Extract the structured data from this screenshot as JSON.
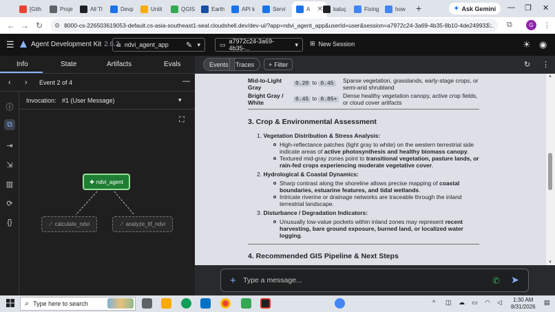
{
  "browser": {
    "tabs": [
      {
        "label": "[Gith",
        "color": "#ea4335"
      },
      {
        "label": "Proje",
        "color": "#5f6368"
      },
      {
        "label": "All Tl",
        "color": "#202124"
      },
      {
        "label": "Devp",
        "color": "#1a73e8"
      },
      {
        "label": "Untit",
        "color": "#f9ab00"
      },
      {
        "label": "QGIS",
        "color": "#34a853"
      },
      {
        "label": "Earth",
        "color": "#174ea6"
      },
      {
        "label": "API k",
        "color": "#1a73e8"
      },
      {
        "label": "Servi",
        "color": "#1a73e8"
      },
      {
        "label": "A",
        "color": "#1a73e8",
        "active": true
      },
      {
        "label": "kaluç",
        "color": "#202124"
      },
      {
        "label": "Fixing",
        "color": "#4285f4"
      },
      {
        "label": "how",
        "color": "#4285f4"
      }
    ],
    "new_tab": "+",
    "ask_gemini": "Ask Gemini",
    "url": "8000-cs-226503619053-default.cs-asia-southeast1-seal.cloudshell.dev/dev-ui/?app=ndvi_agent_app&userId=user&session=a7972c24-3a69-4b35-8b10-4de249933...",
    "profile_initial": "G"
  },
  "app": {
    "title": "Agent Development Kit",
    "version": "2.6.2",
    "app_selector": "ndvi_agent_app",
    "session_selector": "a7972c24-3a69-4b35-...",
    "new_session": "New Session"
  },
  "left": {
    "tabs": [
      "Info",
      "State",
      "Artifacts",
      "Evals"
    ],
    "event_label": "Event 2 of 4",
    "invocation_label": "Invocation:",
    "invocation_value": "#1 (User Message)",
    "graph": {
      "root": "ndvi_agent",
      "tools": [
        "calculate_ndvi",
        "analyze_tif_ndvi"
      ]
    }
  },
  "right": {
    "toggle": [
      "Events",
      "Traces"
    ],
    "filter": "Filter",
    "table_rows": [
      {
        "label": "Mid-to-Light Gray",
        "from": "0.20",
        "to_word": "to",
        "to": "0.45",
        "desc": "Sparse vegetation, grasslands, early-stage crops, or semi-arid shrubland"
      },
      {
        "label": "Bright Gray / White",
        "from": "0.45",
        "to_word": "to",
        "to": "0.85+",
        "desc": "Dense healthy vegetation canopy, active crop fields, or cloud cover artifacts"
      }
    ],
    "section3_title": "3. Crop & Environmental Assessment",
    "items": [
      {
        "num": "1.",
        "title": "Vegetation Distribution & Stress Analysis:",
        "bullets": [
          {
            "lines": [
              "High-reflectance patches (light gray to white) on the western terrestrial side",
              "indicate areas of ",
              "active photosynthesis and healthy biomass canopy",
              "."
            ]
          },
          {
            "lines": [
              "Textured mid-gray zones point to ",
              "transitional vegetation, pasture lands, or",
              "rain-fed crops experiencing moderate vegetative cover",
              "."
            ]
          }
        ]
      },
      {
        "num": "2.",
        "title": "Hydrological & Coastal Dynamics:",
        "bullets": [
          {
            "lines": [
              "Sharp contrast along the shoreline allows precise mapping of ",
              "coastal",
              "boundaries, estuarine features, and tidal wetlands",
              "."
            ]
          },
          {
            "lines": [
              "Intricate riverine or drainage networks are traceable through the inland",
              "terrestrial landscape."
            ]
          }
        ]
      },
      {
        "num": "3.",
        "title": "Disturbance / Degradation Indicators:",
        "bullets": [
          {
            "lines": [
              "Unusually low-value pockets within inland zones may represent ",
              "recent",
              "harvesting, bare ground exposure, burned land, or localized water",
              "logging",
              "."
            ]
          }
        ]
      }
    ],
    "section4_title": "4. Recommended GIS Pipeline & Next Steps",
    "input_placeholder": "Type a message..."
  },
  "taskbar": {
    "search_placeholder": "Type here to search",
    "time": "1:30 AM",
    "date": "8/31/2026"
  }
}
